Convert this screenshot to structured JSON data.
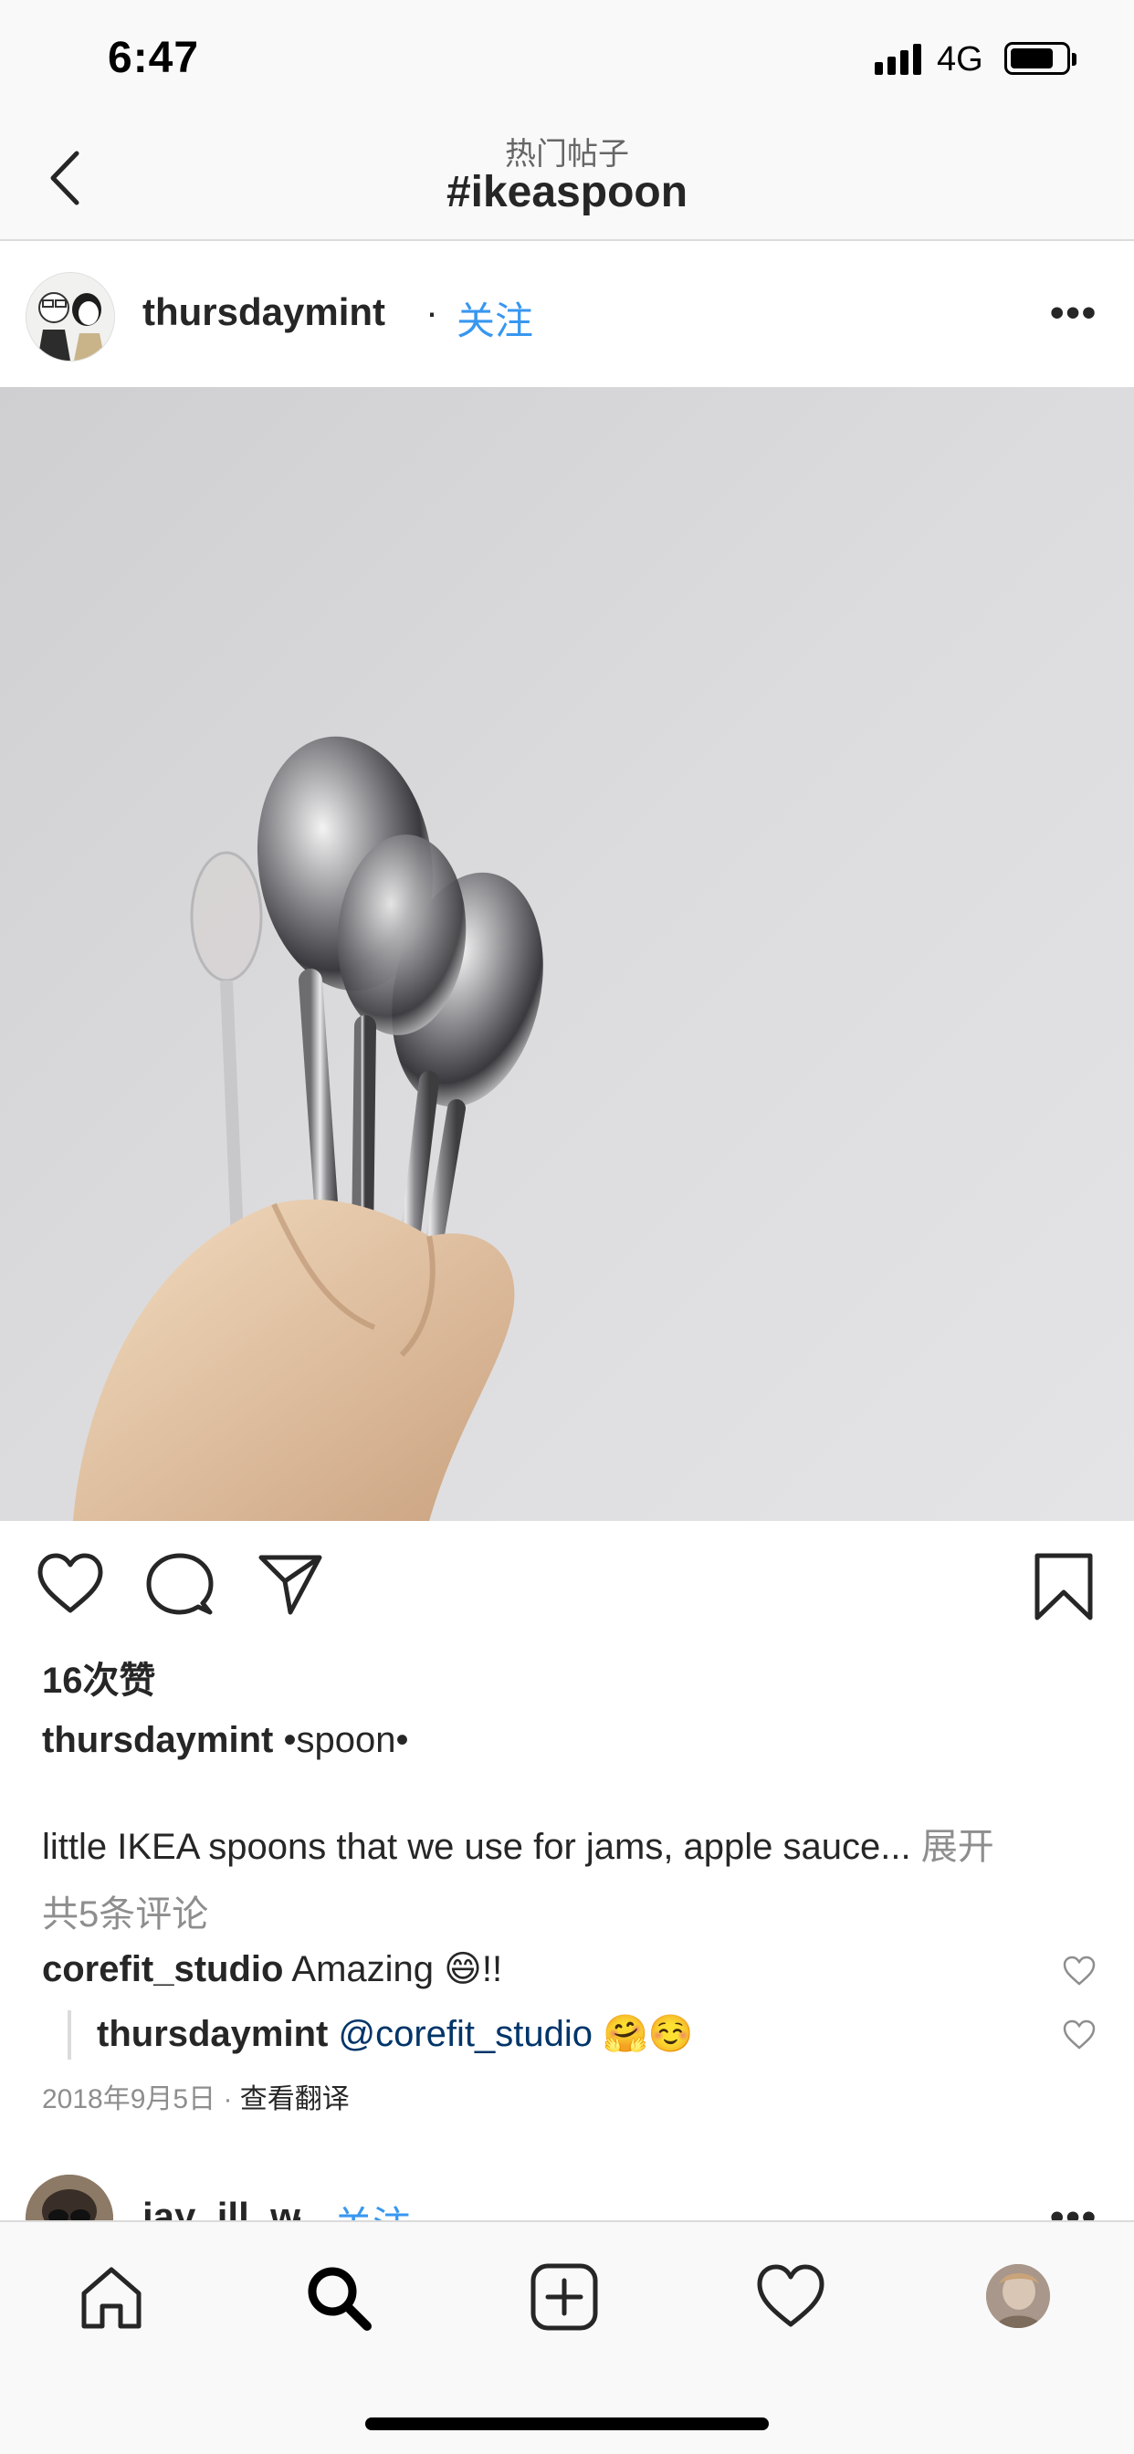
{
  "status_bar": {
    "time": "6:47",
    "network": "4G",
    "battery_level": 0.7
  },
  "header": {
    "subtitle": "热门帖子",
    "title": "#ikeaspoon"
  },
  "post": {
    "author": "thursdaymint",
    "separator": "·",
    "follow_label": "关注",
    "more": "•••",
    "likes": "16次赞",
    "caption_user": "thursdaymint",
    "caption_title": "•spoon•",
    "caption_text": "little IKEA spoons that we use for jams, apple sauce...",
    "caption_more": "展开",
    "view_comments": "共5条评论",
    "comments": [
      {
        "user": "corefit_studio",
        "text": "Amazing 😄!!"
      },
      {
        "user": "thursdaymint",
        "mention": "@corefit_studio",
        "text": "🤗☺️"
      }
    ],
    "date": "2018年9月5日",
    "date_separator": "·",
    "translate": "查看翻译"
  },
  "next_post": {
    "author": "jay_ill_w",
    "separator": "·",
    "follow_label": "关注",
    "more": "•••"
  },
  "icons": {
    "back": "chevron-left-icon",
    "like": "heart-icon",
    "comment": "comment-bubble-icon",
    "share": "paper-plane-icon",
    "save": "bookmark-icon",
    "home": "home-icon",
    "search": "search-icon",
    "new_post": "plus-square-icon",
    "activity": "heart-icon",
    "profile": "avatar"
  },
  "colors": {
    "link": "#3897f0",
    "text": "#262626",
    "muted": "#8e8e8e",
    "mention": "#003569"
  }
}
